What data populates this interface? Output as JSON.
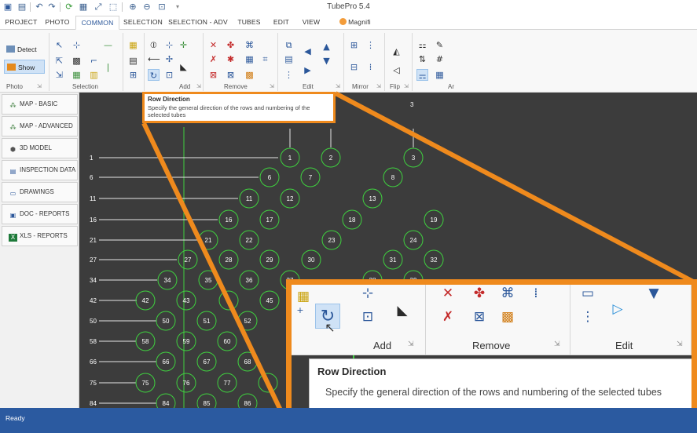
{
  "app": {
    "title": "TubePro 5.4"
  },
  "quick_access": [
    "app-logo-icon",
    "save-icon",
    "undo-icon",
    "redo-icon",
    "refresh-icon",
    "grid-icon",
    "move-icon",
    "pointer-icon",
    "zoom-in-icon",
    "zoom-out-icon",
    "zoom-fit-icon",
    "customize-icon"
  ],
  "tabs": [
    {
      "label": "PROJECT"
    },
    {
      "label": "PHOTO"
    },
    {
      "label": "COMMON",
      "active": true
    },
    {
      "label": "SELECTION"
    },
    {
      "label": "SELECTION - ADV"
    },
    {
      "label": "TUBES"
    },
    {
      "label": "EDIT"
    },
    {
      "label": "VIEW"
    },
    {
      "label": "Magnifi"
    }
  ],
  "ribbon": {
    "photo": {
      "detect": "Detect",
      "show": "Show",
      "group": "Photo"
    },
    "groups": [
      "Selection",
      "Add",
      "Remove",
      "Edit",
      "Mirror",
      "Flip",
      "Ar"
    ]
  },
  "sidebar": {
    "items": [
      {
        "label": "MAP - BASIC",
        "icon": "map-icon"
      },
      {
        "label": "MAP - ADVANCED",
        "icon": "map-icon"
      },
      {
        "label": "3D MODEL",
        "icon": "cube-icon"
      },
      {
        "label": "INSPECTION DATA",
        "icon": "table-icon"
      },
      {
        "label": "DRAWINGS",
        "icon": "drawing-icon"
      },
      {
        "label": "DOC - REPORTS",
        "icon": "document-icon"
      },
      {
        "label": "XLS - REPORTS",
        "icon": "excel-icon"
      }
    ]
  },
  "canvas": {
    "top_labels": [
      "3"
    ],
    "row_labels": [
      "1",
      "6",
      "11",
      "16",
      "21",
      "27",
      "34",
      "42",
      "50",
      "58",
      "66",
      "75",
      "84"
    ],
    "tubes": [
      "1",
      "2",
      "3",
      "6",
      "7",
      "8",
      "11",
      "12",
      "13",
      "16",
      "17",
      "18",
      "19",
      "21",
      "22",
      "23",
      "24",
      "27",
      "28",
      "29",
      "30",
      "31",
      "32",
      "34",
      "35",
      "36",
      "37",
      "38",
      "39",
      "42",
      "43",
      "4",
      "45",
      "50",
      "51",
      "52",
      "58",
      "59",
      "60",
      "66",
      "67",
      "68",
      "75",
      "76",
      "77",
      "8",
      "84",
      "85",
      "86"
    ]
  },
  "tooltip": {
    "title": "Row Direction",
    "description": "Specify the general direction of the rows and numbering of the selected tubes"
  },
  "zoom": {
    "groups": [
      "Add",
      "Remove",
      "Edit"
    ],
    "tooltip_title": "Row Direction",
    "tooltip_description": "Specify the general direction of the rows and numbering of the selected tubes",
    "edge_number": "1"
  },
  "status": {
    "text": "Ready"
  },
  "colors": {
    "accent": "#ef8a1d",
    "canvas_bg": "#3c3c3c",
    "tube_outline": "#3fd13f",
    "status_bar": "#2b5aa0"
  }
}
